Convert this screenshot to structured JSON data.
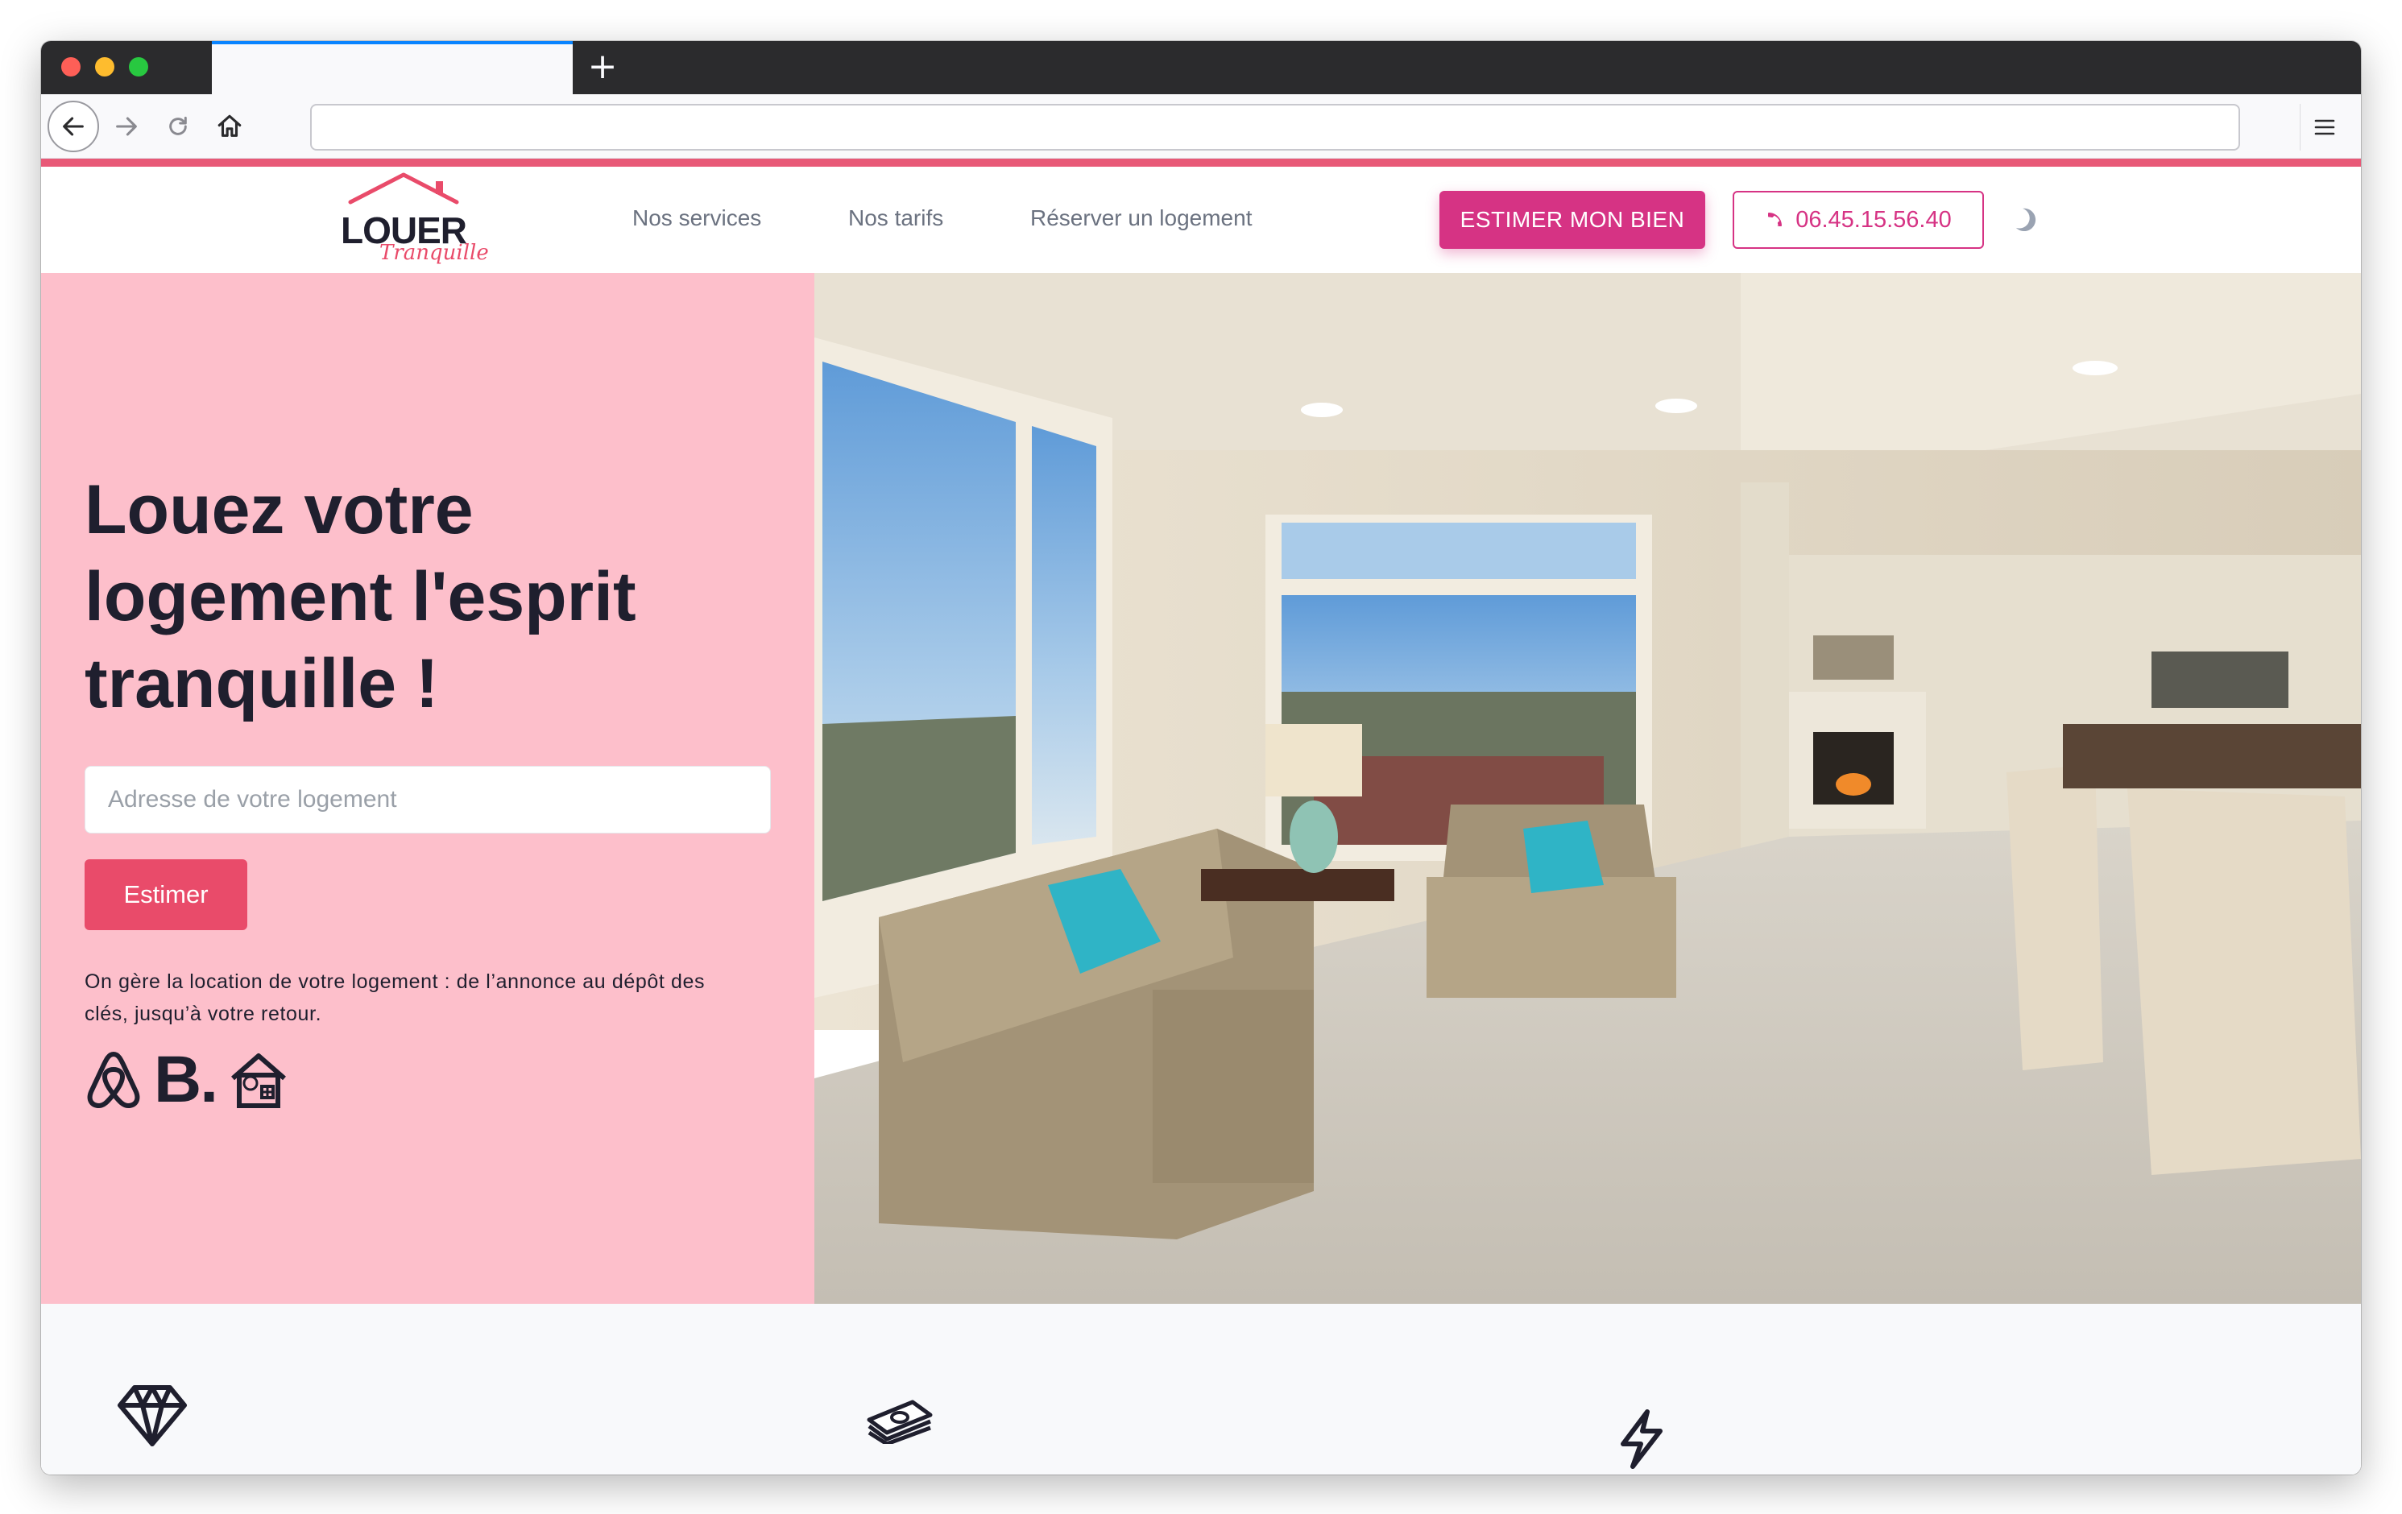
{
  "site": {
    "logo_word": "LOUER",
    "logo_script": "Tranquille",
    "menu": [
      {
        "label": "Nos services"
      },
      {
        "label": "Nos tarifs"
      },
      {
        "label": "Réserver un logement"
      }
    ],
    "cta_label": "ESTIMER MON BIEN",
    "phone": "06.45.15.56.40"
  },
  "hero": {
    "title": "Louez votre logement l'esprit tranquille !",
    "address_placeholder": "Adresse de votre logement",
    "address_value": "",
    "estimate_label": "Estimer",
    "tagline": "On gère la location de votre logement : de l’annonce au dépôt des clés, jusqu’à votre retour.",
    "partners": [
      {
        "icon": "airbnb-icon"
      },
      {
        "text": "B.",
        "icon": "booking-icon"
      },
      {
        "icon": "abritel-house-icon"
      }
    ]
  },
  "features": [
    {
      "icon": "diamond-icon"
    },
    {
      "icon": "money-stack-icon"
    },
    {
      "icon": "lightning-icon"
    }
  ],
  "colors": {
    "brand_pink": "#d63384",
    "hero_pink": "#fdbfcb",
    "estimate_red": "#e94b6a",
    "accent_strip": "#e85977",
    "text_dark": "#1f1f2e"
  }
}
